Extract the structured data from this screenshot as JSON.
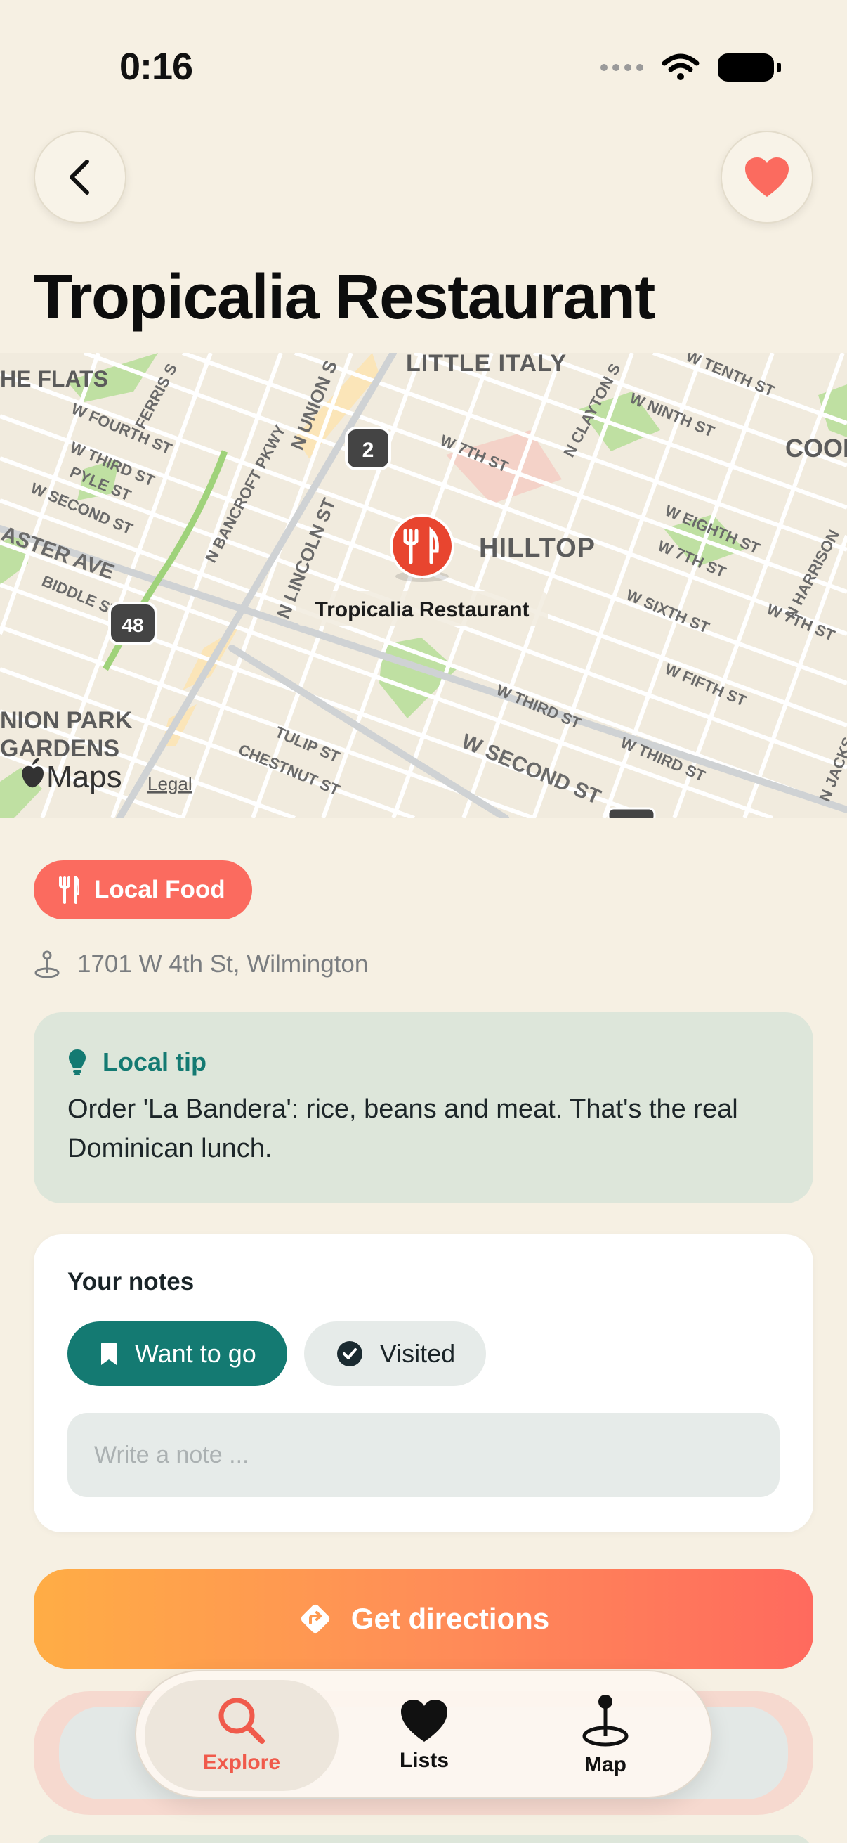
{
  "status": {
    "time": "0:16"
  },
  "header": {
    "title": "Tropicalia Restaurant"
  },
  "map": {
    "pin_label": "Tropicalia Restaurant",
    "labels": {
      "little_italy": "LITTLE ITALY",
      "the_flats": "HE FLATS",
      "hilltop": "HILLTOP",
      "cool": "COOL",
      "union_park": "NION PARK",
      "gardens": "GARDENS",
      "ferris": "FERRIS S",
      "w_fourth": "W FOURTH ST",
      "w_third_left": "W THIRD ST",
      "pyle": "PYLE ST",
      "w_second_left": "W SECOND ST",
      "aster_ave": "ASTER AVE",
      "biddle": "BIDDLE ST",
      "n_bancroft": "N BANCROFT PKWY",
      "n_union": "N UNION S",
      "n_lincoln": "N LINCOLN ST",
      "w_7th_top": "W 7TH ST",
      "n_clayton": "N CLAYTON S",
      "w_ninth": "W NINTH ST",
      "w_tenth": "W TENTH ST",
      "w_eighth": "W EIGHTH ST",
      "w_7th_right": "W 7TH ST",
      "w_sixth": "W SIXTH ST",
      "w_fifth": "W FIFTH ST",
      "w_third_mid": "W THIRD ST",
      "w_third_right": "W THIRD ST",
      "w_second_main": "W SECOND ST",
      "n_harrison": "N HARRISON",
      "w_7th_far": "W 7TH ST",
      "tulip": "TULIP ST",
      "chestnut": "CHESTNUT ST",
      "n_jacks": "N JACKS",
      "route_2": "2",
      "route_48": "48"
    },
    "attribution": "Maps",
    "legal": "Legal"
  },
  "place": {
    "category": "Local Food",
    "address": "1701 W 4th St, Wilmington"
  },
  "tip": {
    "title": "Local tip",
    "text": "Order 'La Bandera': rice, beans and meat. That's the real Dominican lunch."
  },
  "notes": {
    "title": "Your notes",
    "want_to_go": "Want to go",
    "visited": "Visited",
    "placeholder": "Write a note ..."
  },
  "actions": {
    "directions": "Get directions"
  },
  "tabs": [
    {
      "label": "Explore",
      "icon": "magnifier-icon",
      "selected": true
    },
    {
      "label": "Lists",
      "icon": "heart-icon",
      "selected": false
    },
    {
      "label": "Map",
      "icon": "map-pin-icon",
      "selected": false
    }
  ],
  "colors": {
    "background": "#f6f0e3",
    "accent_coral": "#fb6b5f",
    "accent_teal": "#147a72",
    "tip_background": "#dde6da",
    "gradient_start": "#ffad45",
    "gradient_end": "#ff6a5e"
  }
}
